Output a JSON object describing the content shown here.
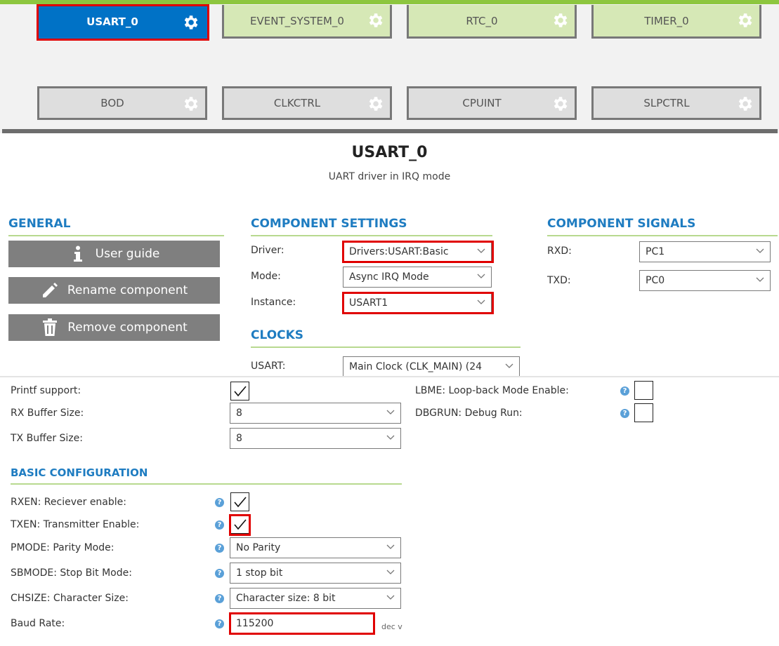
{
  "components": {
    "row1": [
      {
        "label": "USART_0",
        "state": "active"
      },
      {
        "label": "EVENT_SYSTEM_0",
        "state": "green"
      },
      {
        "label": "RTC_0",
        "state": "green"
      },
      {
        "label": "TIMER_0",
        "state": "green"
      }
    ],
    "row2": [
      {
        "label": "BOD",
        "state": "grey"
      },
      {
        "label": "CLKCTRL",
        "state": "grey"
      },
      {
        "label": "CPUINT",
        "state": "grey"
      },
      {
        "label": "SLPCTRL",
        "state": "grey"
      }
    ]
  },
  "detail": {
    "title": "USART_0",
    "subtitle": "UART driver in IRQ mode"
  },
  "general": {
    "heading": "GENERAL",
    "user_guide": "User guide",
    "rename": "Rename component",
    "remove": "Remove component"
  },
  "settings": {
    "heading": "COMPONENT SETTINGS",
    "driver_label": "Driver:",
    "driver_value": "Drivers:USART:Basic",
    "mode_label": "Mode:",
    "mode_value": "Async IRQ Mode",
    "instance_label": "Instance:",
    "instance_value": "USART1"
  },
  "clocks": {
    "heading": "CLOCKS",
    "usart_label": "USART:",
    "usart_value": "Main Clock (CLK_MAIN) (24"
  },
  "signals": {
    "heading": "COMPONENT SIGNALS",
    "rxd_label": "RXD:",
    "rxd_value": "PC1",
    "txd_label": "TXD:",
    "txd_value": "PC0"
  },
  "config": {
    "printf_label": "Printf support:",
    "printf_checked": true,
    "rx_buffer_label": "RX Buffer Size:",
    "rx_buffer_value": "8",
    "tx_buffer_label": "TX Buffer Size:",
    "tx_buffer_value": "8",
    "lbme_label": "LBME: Loop-back Mode Enable:",
    "lbme_checked": false,
    "dbgrun_label": "DBGRUN: Debug Run:",
    "dbgrun_checked": false
  },
  "basic": {
    "heading": "BASIC CONFIGURATION",
    "rxen_label": "RXEN: Reciever enable:",
    "rxen_checked": true,
    "txen_label": "TXEN: Transmitter Enable:",
    "txen_checked": true,
    "pmode_label": "PMODE: Parity Mode:",
    "pmode_value": "No Parity",
    "sbmode_label": "SBMODE: Stop Bit Mode:",
    "sbmode_value": "1 stop bit",
    "chsize_label": "CHSIZE: Character Size:",
    "chsize_value": "Character size: 8 bit",
    "baud_label": "Baud Rate:",
    "baud_value": "115200",
    "baud_unit": "dec v"
  },
  "help_glyph": "?",
  "colors": {
    "accent_blue": "#0072c6",
    "heading_blue": "#1e7cc1",
    "green_tile": "#d6e8b6",
    "grey_tile": "#dedede",
    "highlight_red": "#e00000",
    "button_grey": "#7f7f7f"
  },
  "icons": [
    "gear-icon",
    "info-icon",
    "pencil-icon",
    "trash-icon",
    "chevron-down-icon",
    "checkmark-icon",
    "help-icon"
  ]
}
